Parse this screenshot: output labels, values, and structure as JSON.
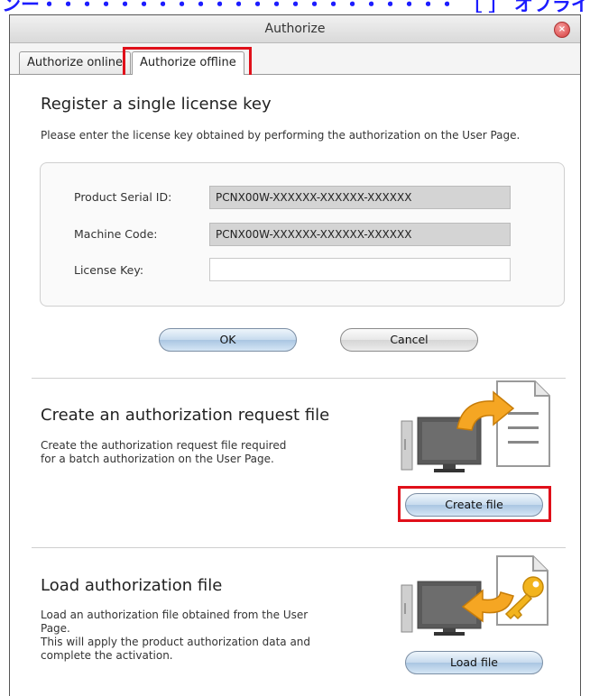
{
  "top_note": "ンー・・・・・・・・・・・・・・・・・・・・・・ ［ ］ オフラインで認証する",
  "window": {
    "title": "Authorize",
    "tabs": [
      "Authorize online",
      "Authorize offline"
    ],
    "active_tab": "Authorize offline"
  },
  "single": {
    "heading": "Register a single license key",
    "description": "Please enter the license key obtained by performing the authorization on the User Page.",
    "fields": {
      "serial_label": "Product Serial ID:",
      "serial_value": "PCNX00W-XXXXXX-XXXXXX-XXXXXX",
      "machine_label": "Machine Code:",
      "machine_value": "PCNX00W-XXXXXX-XXXXXX-XXXXXX",
      "license_label": "License Key:",
      "license_value": ""
    },
    "ok_label": "OK",
    "cancel_label": "Cancel"
  },
  "request": {
    "heading": "Create an authorization request file",
    "description_line1": "Create the authorization request file required",
    "description_line2": "for a batch authorization on the User Page.",
    "button_label": "Create file"
  },
  "load": {
    "heading": "Load authorization file",
    "description_line1": "Load an authorization file obtained from the User",
    "description_line2": "Page.",
    "description_line3": "This will apply the product authorization data and",
    "description_line4": "complete the activation.",
    "button_label": "Load file"
  },
  "colors": {
    "highlight": "#e0101a",
    "button_blue": "#aac6e2",
    "arrow": "#f5a623",
    "key": "#f2b41d"
  },
  "icons": [
    "computer-to-document-icon",
    "key-to-computer-icon",
    "close-icon"
  ]
}
